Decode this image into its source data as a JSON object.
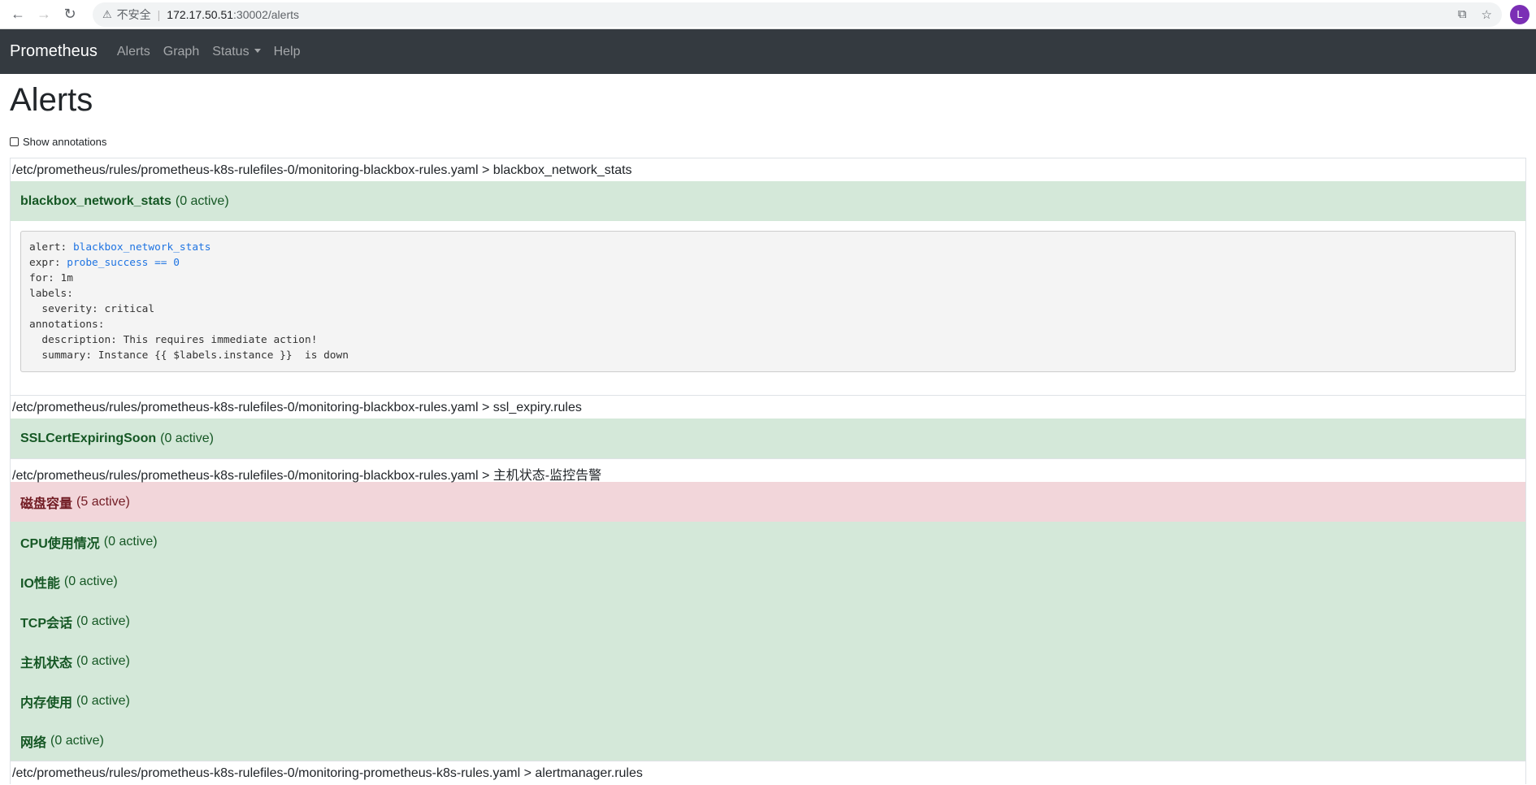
{
  "browser": {
    "insecure_label": "不安全",
    "url_host": "172.17.50.51",
    "url_path": ":30002/alerts",
    "avatar_letter": "L"
  },
  "navbar": {
    "brand": "Prometheus",
    "links": [
      "Alerts",
      "Graph",
      "Status",
      "Help"
    ]
  },
  "page": {
    "title": "Alerts",
    "show_annotations_label": "Show annotations"
  },
  "groups": [
    {
      "header": "/etc/prometheus/rules/prometheus-k8s-rulefiles-0/monitoring-blackbox-rules.yaml > blackbox_network_stats",
      "rules": [
        {
          "name": "blackbox_network_stats",
          "count": "(0 active)",
          "state": "ok",
          "detail": {
            "alert_key": "alert: ",
            "alert_val": "blackbox_network_stats",
            "expr_key": "expr: ",
            "expr_val": "probe_success == 0",
            "for_line": "for: 1m",
            "labels_line": "labels:",
            "severity_line": "  severity: critical",
            "annotations_line": "annotations:",
            "description_line": "  description: This requires immediate action!",
            "summary_line": "  summary: Instance {{ $labels.instance }}  is down"
          }
        }
      ]
    },
    {
      "header": "/etc/prometheus/rules/prometheus-k8s-rulefiles-0/monitoring-blackbox-rules.yaml > ssl_expiry.rules",
      "rules": [
        {
          "name": "SSLCertExpiringSoon",
          "count": "(0 active)",
          "state": "ok"
        }
      ]
    },
    {
      "header": "/etc/prometheus/rules/prometheus-k8s-rulefiles-0/monitoring-blackbox-rules.yaml > 主机状态-监控告警",
      "rules": [
        {
          "name": "磁盘容量",
          "count": "(5 active)",
          "state": "firing"
        },
        {
          "name": "CPU使用情况",
          "count": "(0 active)",
          "state": "ok"
        },
        {
          "name": "IO性能",
          "count": "(0 active)",
          "state": "ok"
        },
        {
          "name": "TCP会话",
          "count": "(0 active)",
          "state": "ok"
        },
        {
          "name": "主机状态",
          "count": "(0 active)",
          "state": "ok"
        },
        {
          "name": "内存使用",
          "count": "(0 active)",
          "state": "ok"
        },
        {
          "name": "网络",
          "count": "(0 active)",
          "state": "ok"
        }
      ]
    },
    {
      "header": "/etc/prometheus/rules/prometheus-k8s-rulefiles-0/monitoring-prometheus-k8s-rules.yaml > alertmanager.rules",
      "rules": []
    }
  ],
  "colors": {
    "navbar_bg": "#343a40",
    "ok_bg": "#d4e8d9",
    "firing_bg": "#f2d6da",
    "link_blue": "#1f74e2"
  }
}
